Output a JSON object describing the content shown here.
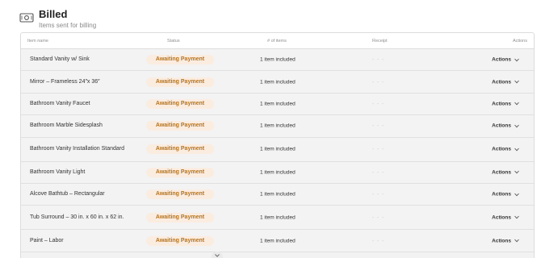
{
  "header": {
    "title": "Billed",
    "subtitle": "Items sent for billing",
    "icon": "money-icon"
  },
  "columns": {
    "name": "Item name",
    "status": "Status",
    "items": "# of items",
    "receipt": "Receipt",
    "actions": "Actions"
  },
  "rows": [
    {
      "name": "Standard Vanity w/ Sink",
      "status": "Awaiting Payment",
      "items": "1 item included",
      "receipt": "- - -",
      "actions": "Actions"
    },
    {
      "name": "Mirror – Frameless 24″x 36″",
      "status": "Awaiting Payment",
      "items": "1 item included",
      "receipt": "- - -",
      "actions": "Actions"
    },
    {
      "name": "Bathroom Vanity Faucet",
      "status": "Awaiting Payment",
      "items": "1 item included",
      "receipt": "- - -",
      "actions": "Actions"
    },
    {
      "name": "Bathroom Marble Sidesplash",
      "status": "Awaiting Payment",
      "items": "1 item included",
      "receipt": "- - -",
      "actions": "Actions"
    },
    {
      "name": "Bathroom Vanity Installation Standard",
      "status": "Awaiting Payment",
      "items": "1 item included",
      "receipt": "- - -",
      "actions": "Actions"
    },
    {
      "name": "Bathroom Vanity Light",
      "status": "Awaiting Payment",
      "items": "1 item included",
      "receipt": "- - -",
      "actions": "Actions"
    },
    {
      "name": "Alcove Bathtub – Rectangular",
      "status": "Awaiting Payment",
      "items": "1 item included",
      "receipt": "- - -",
      "actions": "Actions"
    },
    {
      "name": "Tub Surround – 30 in. x 60 in. x 62 in.",
      "status": "Awaiting Payment",
      "items": "1 item included",
      "receipt": "- - -",
      "actions": "Actions"
    },
    {
      "name": "Paint – Labor",
      "status": "Awaiting Payment",
      "items": "1 item included",
      "receipt": "- - -",
      "actions": "Actions"
    }
  ],
  "colors": {
    "badge_bg": "#fbece0",
    "badge_text": "#b5741e"
  }
}
